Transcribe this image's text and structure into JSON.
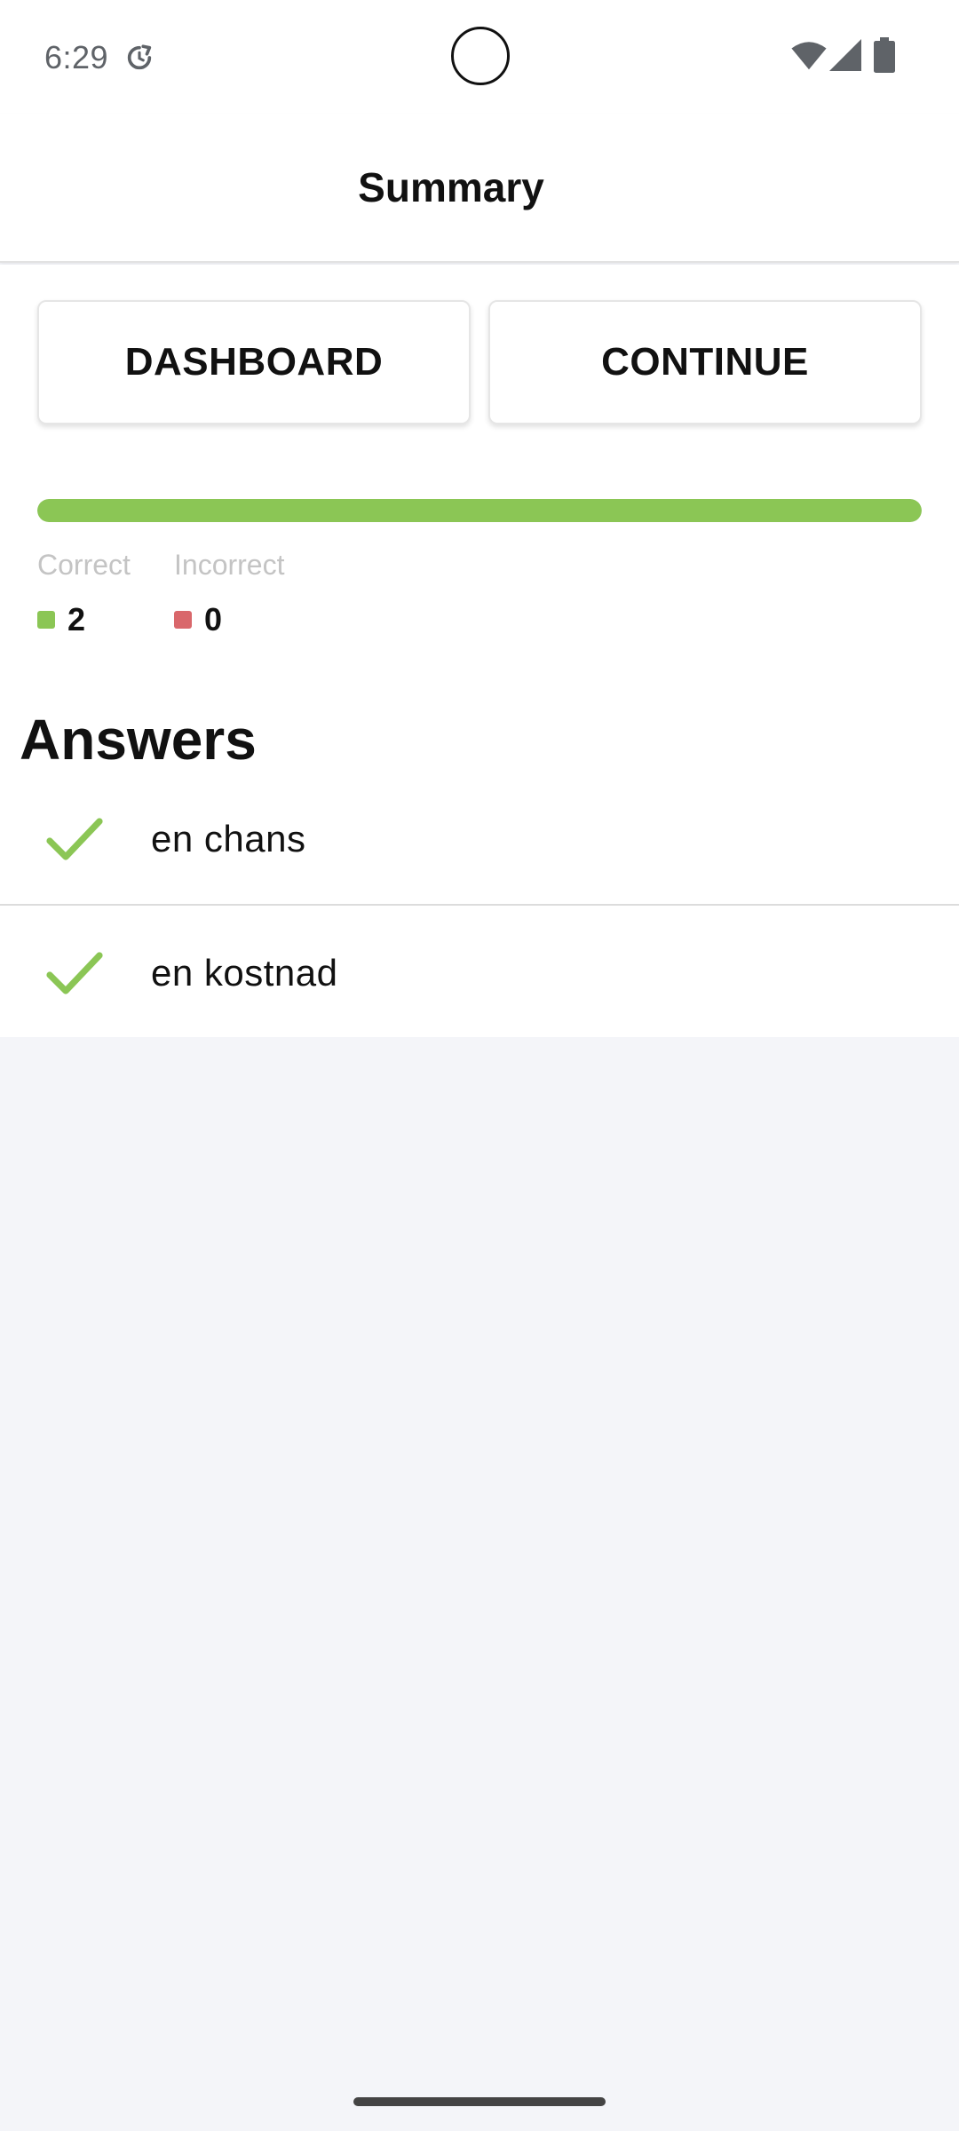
{
  "status_bar": {
    "time": "6:29",
    "icons": [
      "sync-icon",
      "wifi-icon",
      "signal-icon",
      "battery-icon"
    ]
  },
  "header": {
    "title": "Summary"
  },
  "actions": {
    "dashboard_label": "DASHBOARD",
    "continue_label": "CONTINUE"
  },
  "progress": {
    "correct_fraction": 1.0,
    "color": "#8bc655"
  },
  "stats": {
    "correct": {
      "label": "Correct",
      "value": "2",
      "color": "#8bc655"
    },
    "incorrect": {
      "label": "Incorrect",
      "value": "0",
      "color": "#d9676b"
    }
  },
  "answers": {
    "title": "Answers",
    "items": [
      {
        "text": "en chans",
        "status": "correct",
        "icon": "check-icon"
      },
      {
        "text": "en kostnad",
        "status": "correct",
        "icon": "check-icon"
      }
    ]
  }
}
